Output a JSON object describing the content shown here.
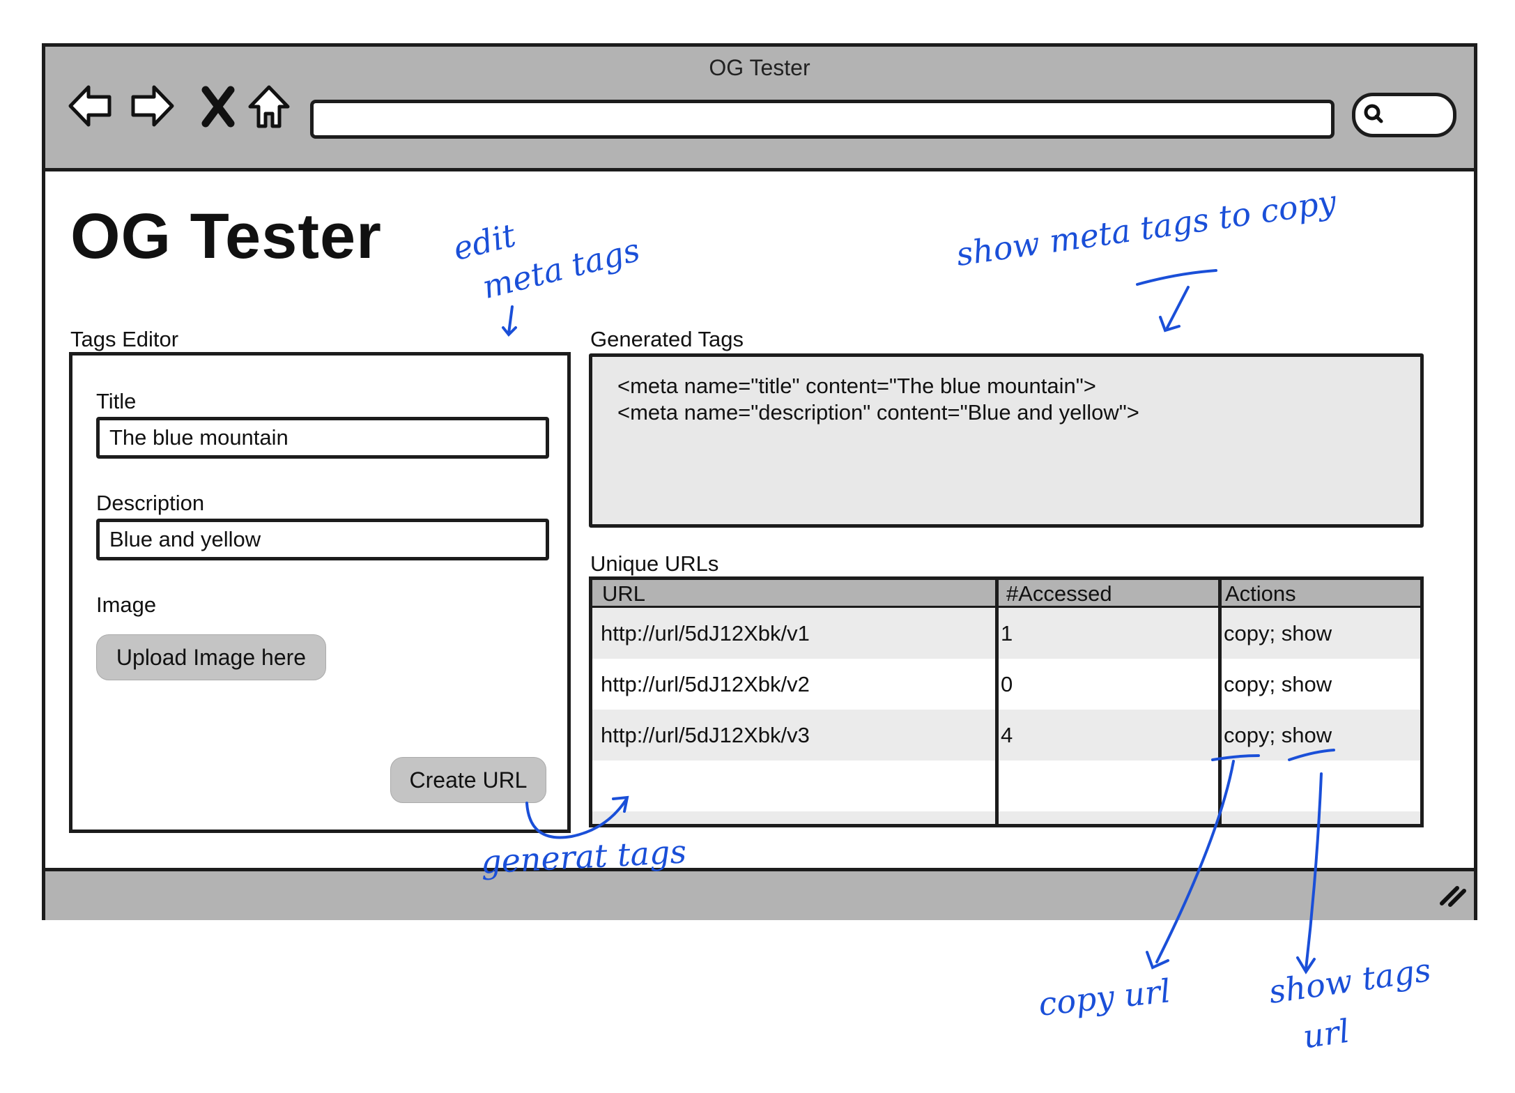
{
  "window": {
    "title": "OG Tester"
  },
  "page": {
    "title": "OG Tester"
  },
  "tags_editor": {
    "heading": "Tags Editor",
    "title_label": "Title",
    "title_value": "The blue mountain",
    "description_label": "Description",
    "description_value": "Blue and yellow",
    "image_label": "Image",
    "upload_button": "Upload Image here",
    "create_button": "Create URL"
  },
  "generated_tags": {
    "heading": "Generated Tags",
    "lines": [
      "<meta name=\"title\" content=\"The blue mountain\">",
      "<meta name=\"description\" content=\"Blue and yellow\">"
    ]
  },
  "unique_urls": {
    "heading": "Unique URLs",
    "columns": [
      "URL",
      "#Accessed",
      "Actions"
    ],
    "rows": [
      {
        "url": "http://url/5dJ12Xbk/v1",
        "accessed": "1",
        "actions": "copy; show"
      },
      {
        "url": "http://url/5dJ12Xbk/v2",
        "accessed": "0",
        "actions": "copy; show"
      },
      {
        "url": "http://url/5dJ12Xbk/v3",
        "accessed": "4",
        "actions": "copy; show"
      }
    ]
  },
  "icons": [
    "back-arrow-icon",
    "forward-arrow-icon",
    "close-icon",
    "home-icon",
    "search-icon",
    "resize-grip-icon"
  ],
  "annotations": {
    "edit_tags_line1": "edit",
    "edit_tags_line2": "meta tags",
    "show_meta": "show   meta tags   to copy",
    "generate_tags": "generat  tags",
    "copy_url": "copy url",
    "show_tags_line1": "show   tags",
    "show_tags_line2": "url"
  },
  "colors": {
    "annotation": "#1a4fd8",
    "chrome": "#b3b3b3",
    "panel": "#e8e8e8",
    "button": "#c4c4c4"
  }
}
